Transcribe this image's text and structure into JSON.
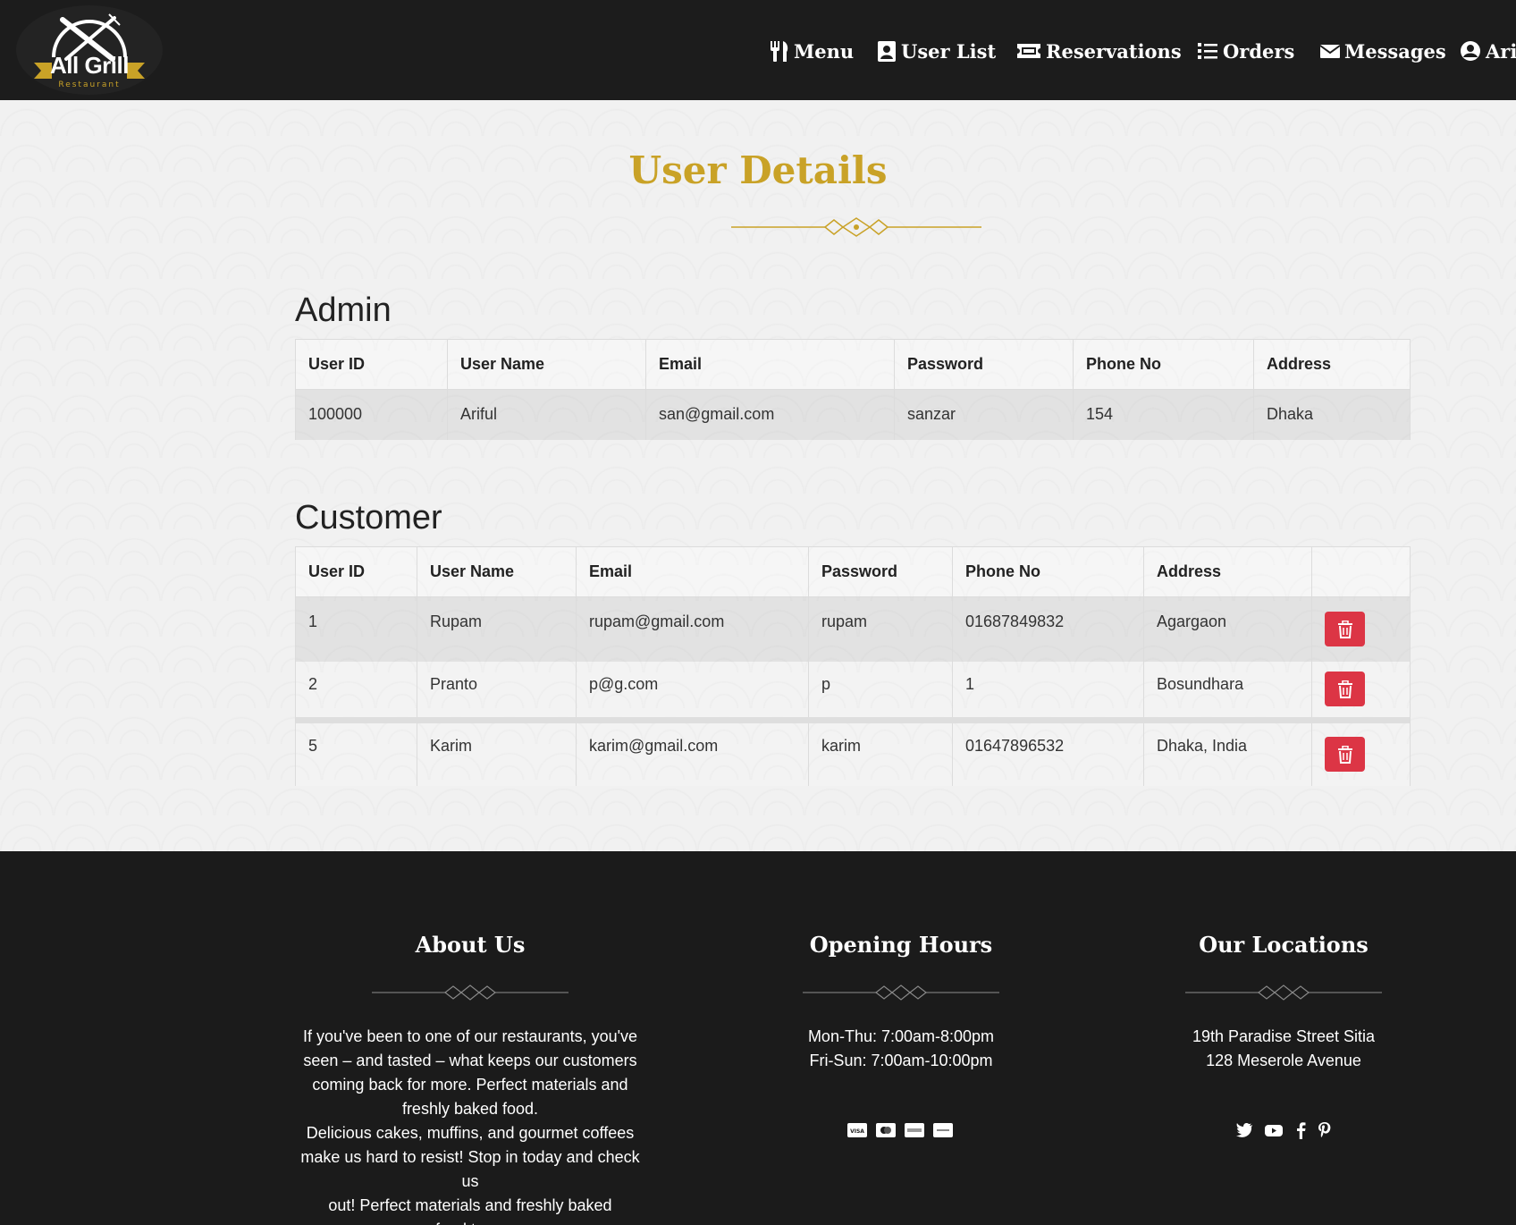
{
  "brand": {
    "name": "All Grill",
    "sub": "Restaurant"
  },
  "nav": [
    {
      "label": "Menu",
      "icon": "utensils-icon"
    },
    {
      "label": "User List",
      "icon": "address-card-icon"
    },
    {
      "label": "Reservations",
      "icon": "ticket-icon"
    },
    {
      "label": "Orders",
      "icon": "list-icon"
    },
    {
      "label": "Messages",
      "icon": "envelope-icon"
    },
    {
      "label": "Arif",
      "icon": "user-circle-icon"
    }
  ],
  "page": {
    "title": "User Details"
  },
  "admin": {
    "title": "Admin",
    "headers": [
      "User ID",
      "User Name",
      "Email",
      "Password",
      "Phone No",
      "Address"
    ],
    "rows": [
      [
        "100000",
        "Ariful",
        "san@gmail.com",
        "sanzar",
        "154",
        "Dhaka"
      ]
    ]
  },
  "customer": {
    "title": "Customer",
    "headers": [
      "User ID",
      "User Name",
      "Email",
      "Password",
      "Phone No",
      "Address",
      ""
    ],
    "rows": [
      [
        "1",
        "Rupam",
        "rupam@gmail.com",
        "rupam",
        "01687849832",
        "Agargaon"
      ],
      [
        "2",
        "Pranto",
        "p@g.com",
        "p",
        "1",
        "Bosundhara"
      ],
      [
        "5",
        "Karim",
        "karim@gmail.com",
        "karim",
        "01647896532",
        "Dhaka, India"
      ]
    ]
  },
  "footer": {
    "about": {
      "title": "About Us",
      "lines": [
        "If you've been to one of our restaurants, you've",
        "seen – and tasted – what keeps our customers",
        "coming back for more. Perfect materials and",
        "freshly baked food.",
        "Delicious cakes, muffins, and gourmet coffees",
        "make us hard to resist! Stop in today and check us",
        "out! Perfect materials and freshly baked",
        "food.town"
      ]
    },
    "hours": {
      "title": "Opening Hours",
      "lines": [
        "Mon-Thu: 7:00am-8:00pm",
        "Fri-Sun: 7:00am-10:00pm"
      ],
      "payment_icons": [
        "visa-icon",
        "mastercard-icon",
        "amex-icon",
        "paypal-icon"
      ]
    },
    "locations": {
      "title": "Our Locations",
      "lines": [
        "19th Paradise Street Sitia",
        "128 Meserole Avenue"
      ],
      "social_icons": [
        "twitter-icon",
        "youtube-icon",
        "facebook-icon",
        "pinterest-icon"
      ]
    }
  },
  "colors": {
    "accent": "#c9a227",
    "danger": "#dc3545",
    "dark": "#1b1b1b"
  }
}
